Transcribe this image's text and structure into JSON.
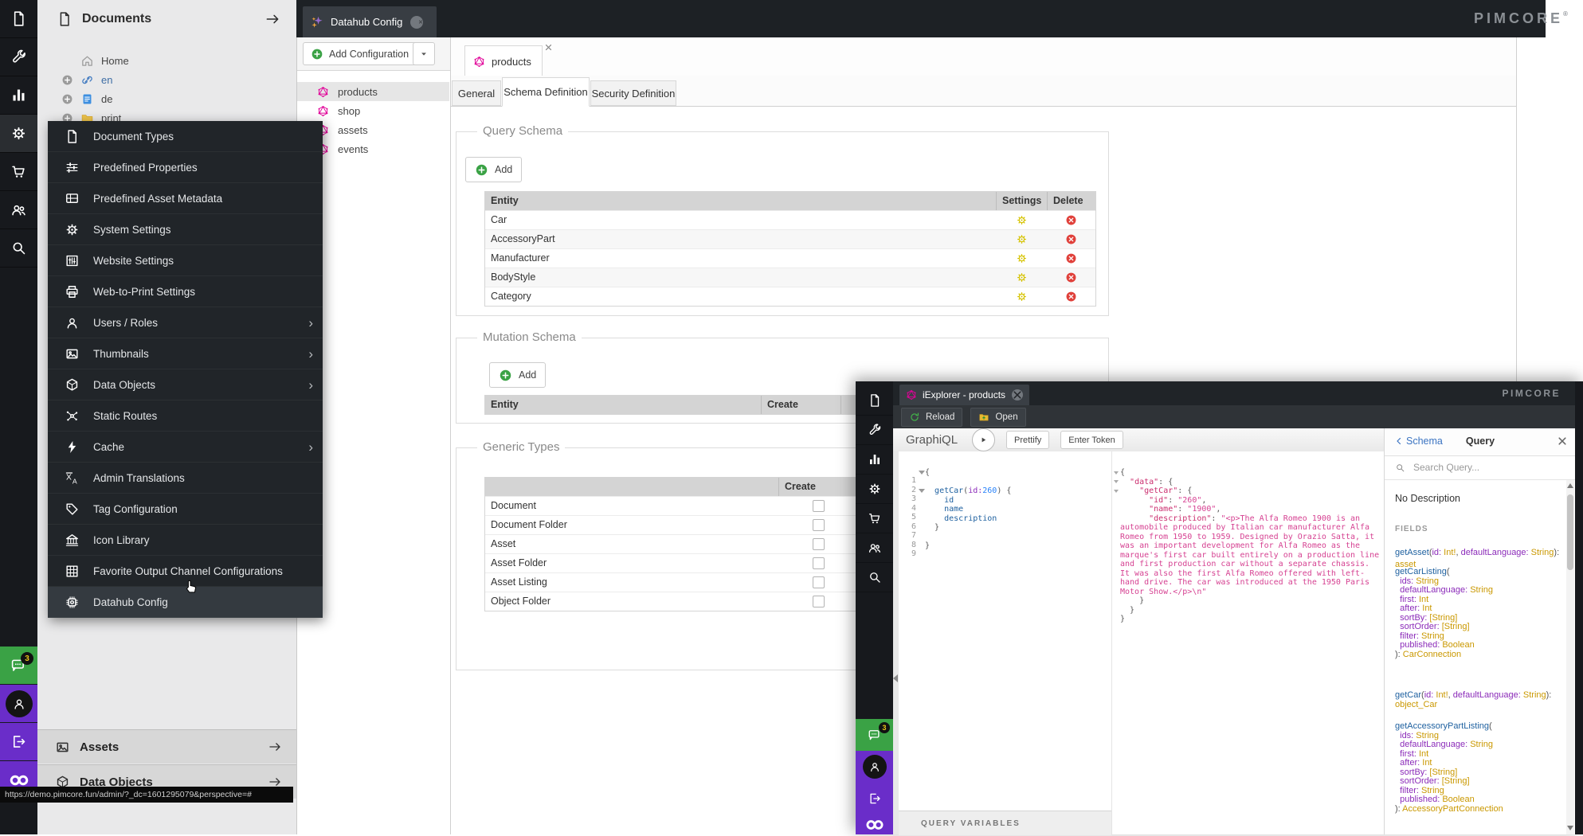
{
  "brand": {
    "logo": "PIMCORE",
    "reg": "®"
  },
  "colors": {
    "accent_green": "#3aa245",
    "pimcore_purple": "#6a2dc9",
    "graphql_pink": "#e10098",
    "gear_yellow": "#d6c300",
    "delete_red": "#e0403a",
    "rail_dark": "#17191d"
  },
  "rail": {
    "items": [
      {
        "name": "documents",
        "icon": "file"
      },
      {
        "name": "tools",
        "icon": "wrench"
      },
      {
        "name": "reports",
        "icon": "chart"
      },
      {
        "name": "settings",
        "icon": "gear",
        "active": true
      },
      {
        "name": "ecommerce",
        "icon": "cart"
      },
      {
        "name": "customers",
        "icon": "users"
      },
      {
        "name": "search",
        "icon": "search"
      }
    ],
    "bottom": [
      {
        "name": "notifications",
        "icon": "chat",
        "badge": "3"
      },
      {
        "name": "profile",
        "icon": "person"
      },
      {
        "name": "logout",
        "icon": "logout"
      },
      {
        "name": "pimcore",
        "icon": "infinity"
      }
    ]
  },
  "documents_panel": {
    "title": "Documents",
    "tree": [
      {
        "label": "Home",
        "icon": "home",
        "expandable": false
      },
      {
        "label": "en",
        "icon": "link",
        "expandable": true
      },
      {
        "label": "de",
        "icon": "bluedoc",
        "expandable": true
      },
      {
        "label": "print",
        "icon": "folder",
        "expandable": true
      }
    ],
    "accordions": [
      {
        "label": "Assets",
        "icon": "image"
      },
      {
        "label": "Data Objects",
        "icon": "cube"
      }
    ]
  },
  "topbar": {
    "tab": {
      "label": "Datahub Config",
      "icon": "sparkles"
    }
  },
  "context_menu": {
    "items": [
      {
        "label": "Document Types",
        "icon": "file"
      },
      {
        "label": "Predefined Properties",
        "icon": "sliders"
      },
      {
        "label": "Predefined Asset Metadata",
        "icon": "meta"
      },
      {
        "label": "System Settings",
        "icon": "gear"
      },
      {
        "label": "Website Settings",
        "icon": "equalizer"
      },
      {
        "label": "Web-to-Print Settings",
        "icon": "printer"
      },
      {
        "label": "Users / Roles",
        "icon": "person",
        "submenu": true
      },
      {
        "label": "Thumbnails",
        "icon": "image",
        "submenu": true
      },
      {
        "label": "Data Objects",
        "icon": "cube",
        "submenu": true
      },
      {
        "label": "Static Routes",
        "icon": "routes"
      },
      {
        "label": "Cache",
        "icon": "lightning",
        "submenu": true
      },
      {
        "label": "Admin Translations",
        "icon": "translate"
      },
      {
        "label": "Tag Configuration",
        "icon": "tag"
      },
      {
        "label": "Icon Library",
        "icon": "bank"
      },
      {
        "label": "Favorite Output Channel Configurations",
        "icon": "grid"
      },
      {
        "label": "Datahub Config",
        "icon": "chip",
        "hover": true
      }
    ],
    "submenu_arrow": "›"
  },
  "datahub_panel": {
    "add_button": "Add Configuration",
    "configs": [
      {
        "label": "products",
        "icon": "graphql",
        "selected": true
      },
      {
        "label": "shop",
        "icon": "graphql"
      },
      {
        "label": "assets",
        "icon": "graphql"
      },
      {
        "label": "events",
        "icon": "graphql"
      }
    ]
  },
  "products_panel": {
    "tab": "products",
    "tabs": [
      "General",
      "Schema Definition",
      "Security Definition"
    ],
    "active_tab": "Schema Definition",
    "query_schema": {
      "legend": "Query Schema",
      "add_label": "Add",
      "columns": [
        "Entity",
        "Settings",
        "Delete"
      ],
      "rows": [
        "Car",
        "AccessoryPart",
        "Manufacturer",
        "BodyStyle",
        "Category"
      ]
    },
    "mutation_schema": {
      "legend": "Mutation Schema",
      "add_label": "Add",
      "columns": [
        "Entity",
        "Create"
      ]
    },
    "generic_types": {
      "legend": "Generic Types",
      "columns": [
        "",
        "Create"
      ],
      "rows": [
        "Document",
        "Document Folder",
        "Asset",
        "Asset Folder",
        "Asset Listing",
        "Object Folder"
      ],
      "checked": false
    }
  },
  "iexplorer": {
    "tab": "iExplorer - products",
    "toolbar": {
      "reload": "Reload",
      "open": "Open"
    },
    "graphiql": {
      "logo": "GraphiQL",
      "prettify": "Prettify",
      "enter_token": "Enter Token",
      "query_variables": "QUERY VARIABLES"
    },
    "editor": {
      "line_numbers_text": "1\n2\n3\n4\n5\n6\n7\n8\n9",
      "lines": [
        [
          {
            "t": "p",
            "s": "{"
          }
        ],
        [],
        [
          {
            "t": "p",
            "s": "  "
          },
          {
            "t": "f",
            "s": "getCar"
          },
          {
            "t": "p",
            "s": "("
          },
          {
            "t": "a",
            "s": "id:"
          },
          {
            "t": "n",
            "s": "260"
          },
          {
            "t": "p",
            "s": ") {"
          }
        ],
        [
          {
            "t": "p",
            "s": "    "
          },
          {
            "t": "f",
            "s": "id"
          }
        ],
        [
          {
            "t": "p",
            "s": "    "
          },
          {
            "t": "f",
            "s": "name"
          }
        ],
        [
          {
            "t": "p",
            "s": "    "
          },
          {
            "t": "f",
            "s": "description"
          }
        ],
        [
          {
            "t": "p",
            "s": "  }"
          }
        ],
        [],
        [
          {
            "t": "p",
            "s": "}"
          }
        ]
      ]
    },
    "results": {
      "lines": [
        [
          {
            "t": "p",
            "s": "{"
          }
        ],
        [
          {
            "t": "p",
            "s": "  "
          },
          {
            "t": "k",
            "s": "\"data\""
          },
          {
            "t": "p",
            "s": ": {"
          }
        ],
        [
          {
            "t": "p",
            "s": "    "
          },
          {
            "t": "k",
            "s": "\"getCar\""
          },
          {
            "t": "p",
            "s": ": {"
          }
        ],
        [
          {
            "t": "p",
            "s": "      "
          },
          {
            "t": "k",
            "s": "\"id\""
          },
          {
            "t": "p",
            "s": ": "
          },
          {
            "t": "s",
            "s": "\"260\""
          },
          {
            "t": "p",
            "s": ","
          }
        ],
        [
          {
            "t": "p",
            "s": "      "
          },
          {
            "t": "k",
            "s": "\"name\""
          },
          {
            "t": "p",
            "s": ": "
          },
          {
            "t": "s",
            "s": "\"1900\""
          },
          {
            "t": "p",
            "s": ","
          }
        ],
        [
          {
            "t": "p",
            "s": "      "
          },
          {
            "t": "k",
            "s": "\"description\""
          },
          {
            "t": "p",
            "s": ": "
          },
          {
            "t": "s",
            "s": "\"<p>The Alfa Romeo 1900 is an automobile produced by Italian car manufacturer Alfa Romeo from 1950 to 1959. Designed by Orazio Satta, it was an important development for Alfa Romeo as the marque's first car built entirely on a production line and first production car without a separate chassis. It was also the first Alfa Romeo offered with left-hand drive. The car was introduced at the 1950 Paris Motor Show.</p>\\n\""
          }
        ],
        [
          {
            "t": "p",
            "s": "    }"
          }
        ],
        [
          {
            "t": "p",
            "s": "  }"
          }
        ],
        [
          {
            "t": "p",
            "s": "}"
          }
        ]
      ]
    },
    "docs": {
      "back_label": "Schema",
      "title": "Query",
      "search_placeholder": "Search Query...",
      "no_description": "No Description",
      "fields_label": "FIELDS",
      "fields": [
        {
          "lines": [
            [
              {
                "t": "f",
                "s": "getAsset"
              },
              {
                "t": "p",
                "s": "("
              },
              {
                "t": "a",
                "s": "id:"
              },
              {
                "t": "y",
                "s": " Int!"
              },
              {
                "t": "p",
                "s": ", "
              },
              {
                "t": "a",
                "s": "defaultLanguage:"
              },
              {
                "t": "y",
                "s": " String"
              },
              {
                "t": "p",
                "s": "): "
              },
              {
                "t": "y",
                "s": "asset"
              }
            ]
          ]
        },
        {
          "lines": [
            [
              {
                "t": "f",
                "s": "getCarListing"
              },
              {
                "t": "p",
                "s": "("
              }
            ],
            [
              {
                "t": "a",
                "s": "  ids:"
              },
              {
                "t": "y",
                "s": " String"
              }
            ],
            [
              {
                "t": "a",
                "s": "  defaultLanguage:"
              },
              {
                "t": "y",
                "s": " String"
              }
            ],
            [
              {
                "t": "a",
                "s": "  first:"
              },
              {
                "t": "y",
                "s": " Int"
              }
            ],
            [
              {
                "t": "a",
                "s": "  after:"
              },
              {
                "t": "y",
                "s": " Int"
              }
            ],
            [
              {
                "t": "a",
                "s": "  sortBy:"
              },
              {
                "t": "y",
                "s": " [String]"
              }
            ],
            [
              {
                "t": "a",
                "s": "  sortOrder:"
              },
              {
                "t": "y",
                "s": " [String]"
              }
            ],
            [
              {
                "t": "a",
                "s": "  filter:"
              },
              {
                "t": "y",
                "s": " String"
              }
            ],
            [
              {
                "t": "a",
                "s": "  published:"
              },
              {
                "t": "y",
                "s": " Boolean"
              }
            ],
            [
              {
                "t": "p",
                "s": "): "
              },
              {
                "t": "y",
                "s": "CarConnection"
              }
            ]
          ]
        },
        {
          "lines": [
            [
              {
                "t": "f",
                "s": "getCar"
              },
              {
                "t": "p",
                "s": "("
              },
              {
                "t": "a",
                "s": "id:"
              },
              {
                "t": "y",
                "s": " Int!"
              },
              {
                "t": "p",
                "s": ", "
              },
              {
                "t": "a",
                "s": "defaultLanguage:"
              },
              {
                "t": "y",
                "s": " String"
              },
              {
                "t": "p",
                "s": "): "
              }
            ],
            [
              {
                "t": "y",
                "s": "object_Car"
              }
            ]
          ]
        },
        {
          "lines": [
            [
              {
                "t": "f",
                "s": "getAccessoryPartListing"
              },
              {
                "t": "p",
                "s": "("
              }
            ],
            [
              {
                "t": "a",
                "s": "  ids:"
              },
              {
                "t": "y",
                "s": " String"
              }
            ],
            [
              {
                "t": "a",
                "s": "  defaultLanguage:"
              },
              {
                "t": "y",
                "s": " String"
              }
            ],
            [
              {
                "t": "a",
                "s": "  first:"
              },
              {
                "t": "y",
                "s": " Int"
              }
            ],
            [
              {
                "t": "a",
                "s": "  after:"
              },
              {
                "t": "y",
                "s": " Int"
              }
            ],
            [
              {
                "t": "a",
                "s": "  sortBy:"
              },
              {
                "t": "y",
                "s": " [String]"
              }
            ],
            [
              {
                "t": "a",
                "s": "  sortOrder:"
              },
              {
                "t": "y",
                "s": " [String]"
              }
            ],
            [
              {
                "t": "a",
                "s": "  filter:"
              },
              {
                "t": "y",
                "s": " String"
              }
            ],
            [
              {
                "t": "a",
                "s": "  published:"
              },
              {
                "t": "y",
                "s": " Boolean"
              }
            ],
            [
              {
                "t": "p",
                "s": "): "
              },
              {
                "t": "y",
                "s": "AccessoryPartConnection"
              }
            ]
          ]
        }
      ]
    }
  },
  "statusbar": {
    "url": "https://demo.pimcore.fun/admin/?_dc=1601295079&perspective=#"
  }
}
